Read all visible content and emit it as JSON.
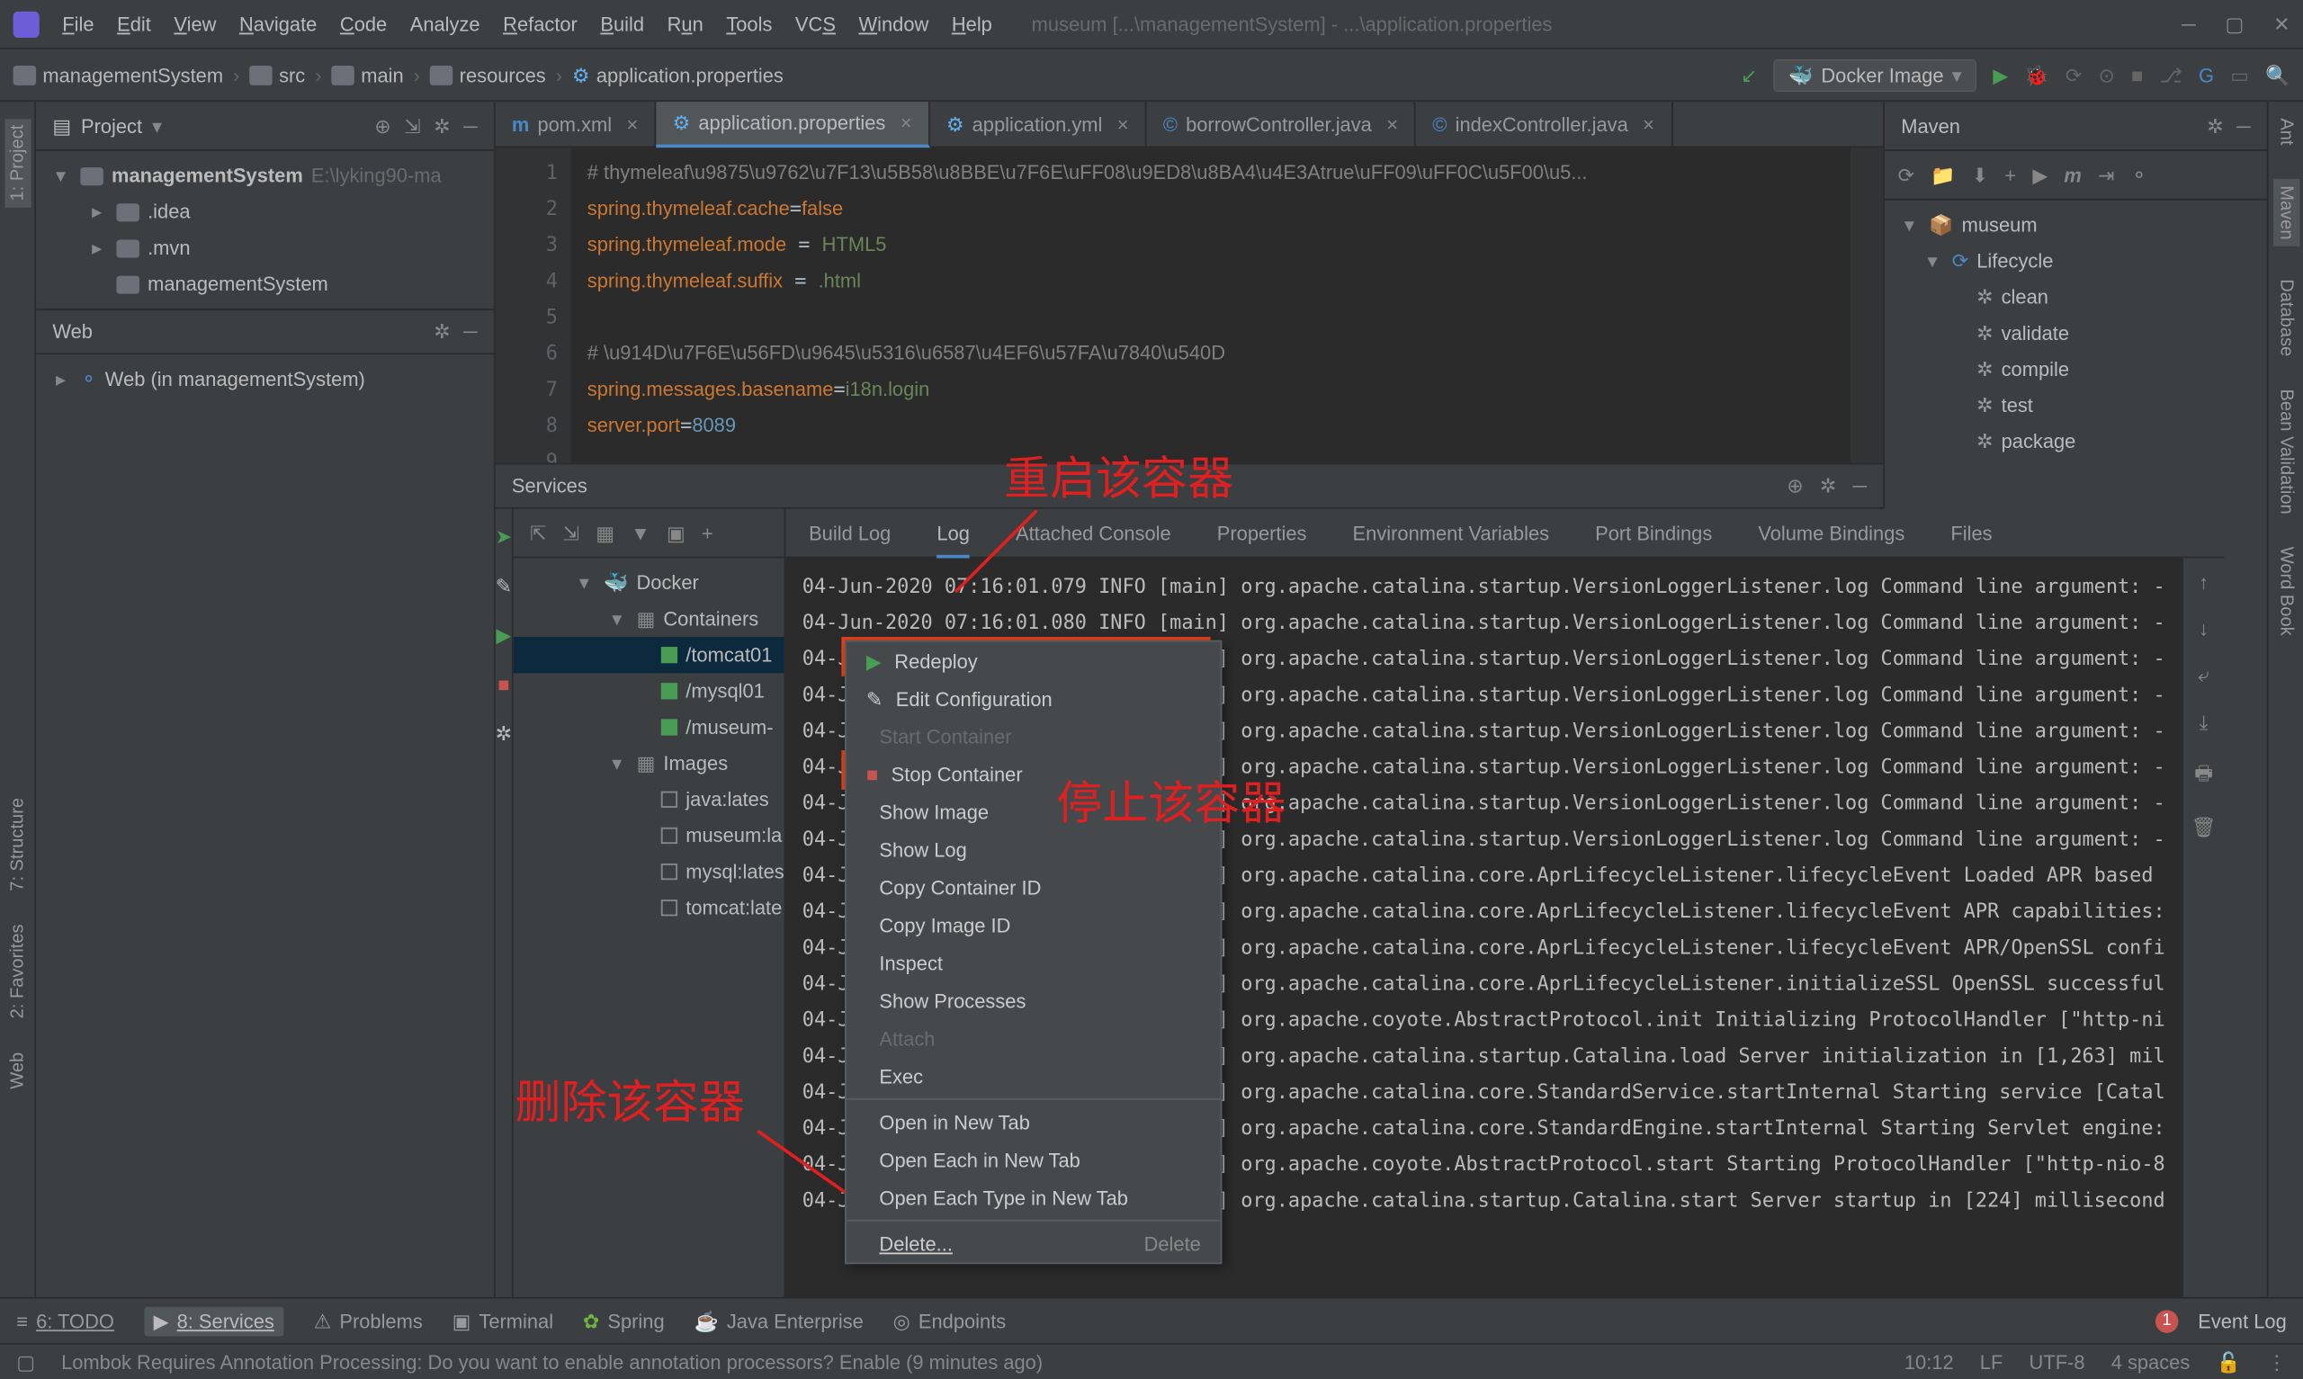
{
  "menu": {
    "items": [
      "File",
      "Edit",
      "View",
      "Navigate",
      "Code",
      "Analyze",
      "Refactor",
      "Build",
      "Run",
      "Tools",
      "VCS",
      "Window",
      "Help"
    ]
  },
  "title_path": "museum [...\\managementSystem] - ...\\application.properties",
  "breadcrumbs": [
    "managementSystem",
    "src",
    "main",
    "resources",
    "application.properties"
  ],
  "docker_btn": "Docker Image",
  "project": {
    "header": "Project",
    "root": "managementSystem",
    "root_path": "E:\\lyking90-ma",
    "folders": [
      ".idea",
      ".mvn",
      "managementSystem"
    ]
  },
  "web": {
    "header": "Web",
    "item": "Web (in managementSystem)"
  },
  "tabs": [
    {
      "icon": "m",
      "label": "pom.xml"
    },
    {
      "icon": "p",
      "label": "application.properties",
      "active": true
    },
    {
      "icon": "p",
      "label": "application.yml"
    },
    {
      "icon": "c",
      "label": "borrowController.java"
    },
    {
      "icon": "c",
      "label": "indexController.java"
    }
  ],
  "code_lines": [
    {
      "n": 1,
      "t": "cm",
      "txt": "# thymeleaf\\u9875\\u9762\\u7F13\\u5B58\\u8BBE\\u7F6E\\uFF08\\u9ED8\\u8BA4\\u4E3Atrue\\uFF09\\uFF0C\\u5F00\\u5..."
    },
    {
      "n": 2,
      "txt": "spring.thymeleaf.cache=false"
    },
    {
      "n": 3,
      "txt": "spring.thymeleaf.mode = HTML5"
    },
    {
      "n": 4,
      "txt": "spring.thymeleaf.suffix = .html"
    },
    {
      "n": 5,
      "txt": ""
    },
    {
      "n": 6,
      "t": "cm",
      "txt": "# \\u914D\\u7F6E\\u56FD\\u9645\\u5316\\u6587\\u4EF6\\u57FA\\u7840\\u540D"
    },
    {
      "n": 7,
      "txt": "spring.messages.basename=i18n.login"
    },
    {
      "n": 8,
      "txt": "server.port=8089"
    },
    {
      "n": 9,
      "txt": ""
    }
  ],
  "services": {
    "header": "Services",
    "tree": {
      "root": "Docker",
      "containers": "Containers",
      "containers_list": [
        "/tomcat01",
        "/mysql01",
        "/museum-"
      ],
      "images": "Images",
      "images_list": [
        "java:lates",
        "museum:la",
        "mysql:lates",
        "tomcat:late"
      ]
    }
  },
  "context_menu": [
    {
      "label": "Redeploy",
      "icon": "play",
      "hot": true
    },
    {
      "label": "Edit Configuration",
      "icon": "edit"
    },
    {
      "label": "Start Container",
      "disabled": true
    },
    {
      "label": "Stop Container",
      "icon": "stop",
      "hot": true
    },
    {
      "label": "Show Image"
    },
    {
      "label": "Show Log"
    },
    {
      "label": "Copy Container ID"
    },
    {
      "label": "Copy Image ID"
    },
    {
      "label": "Inspect"
    },
    {
      "label": "Show Processes"
    },
    {
      "label": "Attach",
      "disabled": true
    },
    {
      "label": "Exec"
    },
    {
      "sep": true
    },
    {
      "label": "Open in New Tab"
    },
    {
      "label": "Open Each in New Tab"
    },
    {
      "label": "Open Each Type in New Tab"
    },
    {
      "sep": true
    },
    {
      "label": "Delete...",
      "shortcut": "Delete",
      "hot": true
    }
  ],
  "console_tabs": [
    "Build Log",
    "Log",
    "Attached Console",
    "Properties",
    "Environment Variables",
    "Port Bindings",
    "Volume Bindings",
    "Files"
  ],
  "console_active": "Log",
  "console_lines": [
    "04-Jun-2020 07:16:01.079 INFO [main] org.apache.catalina.startup.VersionLoggerListener.log Command line argument: -",
    "04-Jun-2020 07:16:01.080 INFO [main] org.apache.catalina.startup.VersionLoggerListener.log Command line argument: -",
    "04-Jun-2020 07:16:01.081 INFO [main] org.apache.catalina.startup.VersionLoggerListener.log Command line argument: -",
    "04-Jun-2020 07:16:01.082 INFO [main] org.apache.catalina.startup.VersionLoggerListener.log Command line argument: -",
    "04-Jun-2020 07:16:01.083 INFO [main] org.apache.catalina.startup.VersionLoggerListener.log Command line argument: -",
    "04-Jun-2020 07:16:01.083 INFO [main] org.apache.catalina.startup.VersionLoggerListener.log Command line argument: -",
    "04-Jun-2020 07:16:01.083 INFO [main] org.apache.catalina.startup.VersionLoggerListener.log Command line argument: -",
    "04-Jun-2020 07:16:01.083 INFO [main] org.apache.catalina.startup.VersionLoggerListener.log Command line argument: -",
    "04-Jun-2020 07:16:01.083 INFO [main] org.apache.catalina.core.AprLifecycleListener.lifecycleEvent Loaded APR based ",
    "04-Jun-2020 07:16:01.084 INFO [main] org.apache.catalina.core.AprLifecycleListener.lifecycleEvent APR capabilities:",
    "04-Jun-2020 07:16:01.084 INFO [main] org.apache.catalina.core.AprLifecycleListener.lifecycleEvent APR/OpenSSL confi",
    "04-Jun-2020 07:16:01.104 INFO [main] org.apache.catalina.core.AprLifecycleListener.initializeSSL OpenSSL successful",
    "04-Jun-2020 07:16:01.753 INFO [main] org.apache.coyote.AbstractProtocol.init Initializing ProtocolHandler [\"http-ni",
    "04-Jun-2020 07:16:01.839 INFO [main] org.apache.catalina.startup.Catalina.load Server initialization in [1,263] mil",
    "04-Jun-2020 07:16:01.980 INFO [main] org.apache.catalina.core.StandardService.startInternal Starting service [Catal",
    "04-Jun-2020 07:16:01.981 INFO [main] org.apache.catalina.core.StandardEngine.startInternal Starting Servlet engine:",
    "04-Jun-2020 07:16:02.031 INFO [main] org.apache.coyote.AbstractProtocol.start Starting ProtocolHandler [\"http-nio-8",
    "04-Jun-2020 07:16:02.065 INFO [main] org.apache.catalina.startup.Catalina.start Server startup in [224] millisecond"
  ],
  "maven": {
    "header": "Maven",
    "root": "museum",
    "lifecycle": "Lifecycle",
    "goals": [
      "clean",
      "validate",
      "compile",
      "test",
      "package"
    ]
  },
  "annotations": {
    "restart": "重启该容器",
    "stop": "停止该容器",
    "delete": "删除该容器"
  },
  "bottom": {
    "items": [
      {
        "label": "6: TODO",
        "icon": "≡"
      },
      {
        "label": "8: Services",
        "icon": "▶",
        "active": true
      },
      {
        "label": "Problems",
        "icon": "⚠"
      },
      {
        "label": "Terminal",
        "icon": "▣"
      },
      {
        "label": "Spring",
        "icon": "✿"
      },
      {
        "label": "Java Enterprise",
        "icon": "☕"
      },
      {
        "label": "Endpoints",
        "icon": "◎"
      }
    ],
    "event_log": "Event Log",
    "event_count": "1"
  },
  "status": {
    "msg": "Lombok Requires Annotation Processing: Do you want to enable annotation processors? Enable (9 minutes ago)",
    "pos": "10:12",
    "lf": "LF",
    "enc": "UTF-8",
    "indent": "4 spaces"
  },
  "side_tabs": {
    "left_top": "1: Project",
    "left_vert": [
      "7: Structure",
      "2: Favorites",
      "Web"
    ],
    "right_vert": [
      "Ant",
      "Maven",
      "Database",
      "Bean Validation",
      "Word Book"
    ]
  }
}
